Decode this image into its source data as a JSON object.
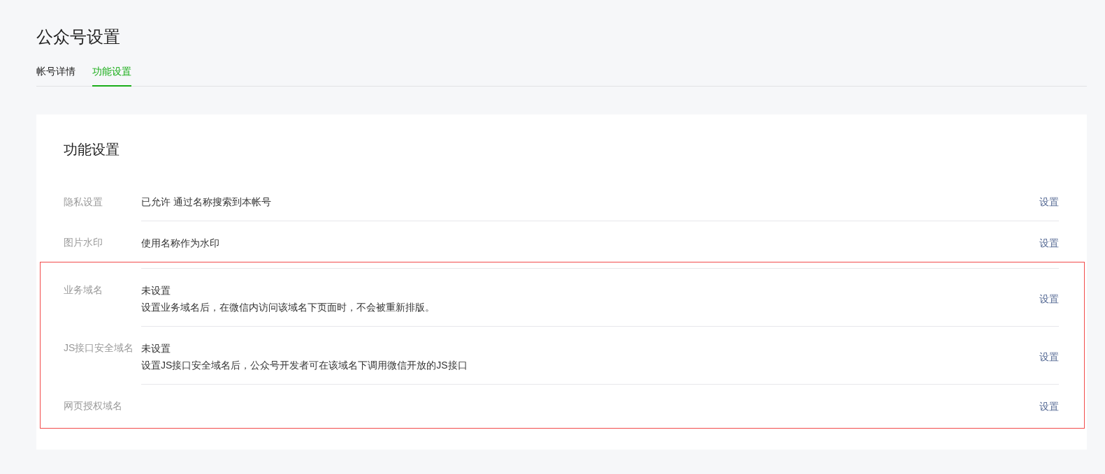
{
  "page_title": "公众号设置",
  "tabs": [
    {
      "label": "帐号详情",
      "selected": false
    },
    {
      "label": "功能设置",
      "selected": true
    }
  ],
  "section": {
    "title": "功能设置",
    "rows": [
      {
        "label": "隐私设置",
        "lines": [
          "已允许 通过名称搜索到本帐号"
        ],
        "action": "设置",
        "highlighted": false
      },
      {
        "label": "图片水印",
        "lines": [
          "使用名称作为水印"
        ],
        "action": "设置",
        "highlighted": false
      },
      {
        "label": "业务域名",
        "lines": [
          "未设置",
          "设置业务域名后，在微信内访问该域名下页面时，不会被重新排版。"
        ],
        "action": "设置",
        "highlighted": true
      },
      {
        "label": "JS接口安全域名",
        "lines": [
          "未设置",
          "设置JS接口安全域名后，公众号开发者可在该域名下调用微信开放的JS接口"
        ],
        "action": "设置",
        "highlighted": true
      },
      {
        "label": "网页授权域名",
        "action": "设置",
        "highlighted": true
      }
    ]
  }
}
